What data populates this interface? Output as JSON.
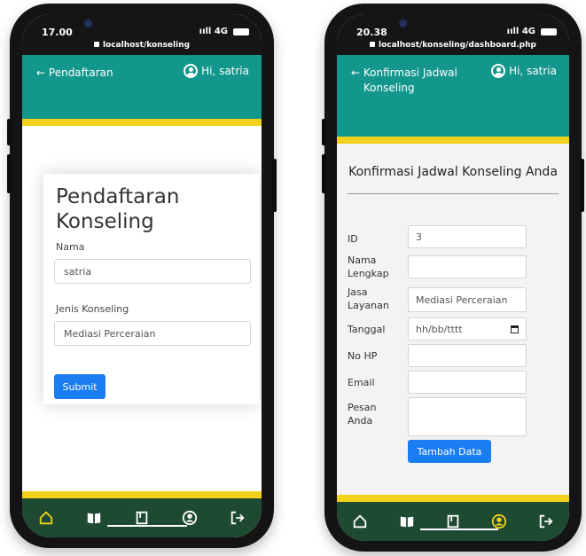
{
  "left": {
    "status": {
      "time": "17.00",
      "signal": "ııll 4G",
      "url": "localhost/konseling"
    },
    "appbar": {
      "back_label": "Pendaftaran",
      "greeting": "Hi, satria"
    },
    "form": {
      "title": "Pendaftaran Konseling",
      "nama_label": "Nama",
      "nama_value": "satria",
      "jenis_label": "Jenis Konseling",
      "jenis_value": "Mediasi Perceraian",
      "submit_label": "Submit"
    },
    "nav_active": "home-icon"
  },
  "right": {
    "status": {
      "time": "20.38",
      "signal": "ııll 4G",
      "url": "localhost/konseling/dashboard.php"
    },
    "appbar": {
      "back_label": "Konfirmasi Jadwal Konseling",
      "greeting": "Hi, satria"
    },
    "form": {
      "title": "Konfirmasi Jadwal Konseling Anda",
      "id_label": "ID",
      "id_value": "3",
      "nama_label": "Nama Lengkap",
      "nama_value": "",
      "jasa_label": "Jasa Layanan",
      "jasa_value": "Mediasi Perceraian",
      "tanggal_label": "Tanggal",
      "tanggal_placeholder": "hh/bb/tttt",
      "hp_label": "No HP",
      "hp_value": "",
      "email_label": "Email",
      "email_value": "",
      "pesan_label": "Pesan Anda",
      "pesan_value": "",
      "submit_label": "Tambah Data"
    },
    "nav_active": "profile-icon"
  },
  "colors": {
    "teal": "#13968b",
    "yellow": "#f2d21b",
    "nav_green": "#1d4a31",
    "primary_blue": "#1a7ef2",
    "active_icon": "#f2d21b"
  }
}
